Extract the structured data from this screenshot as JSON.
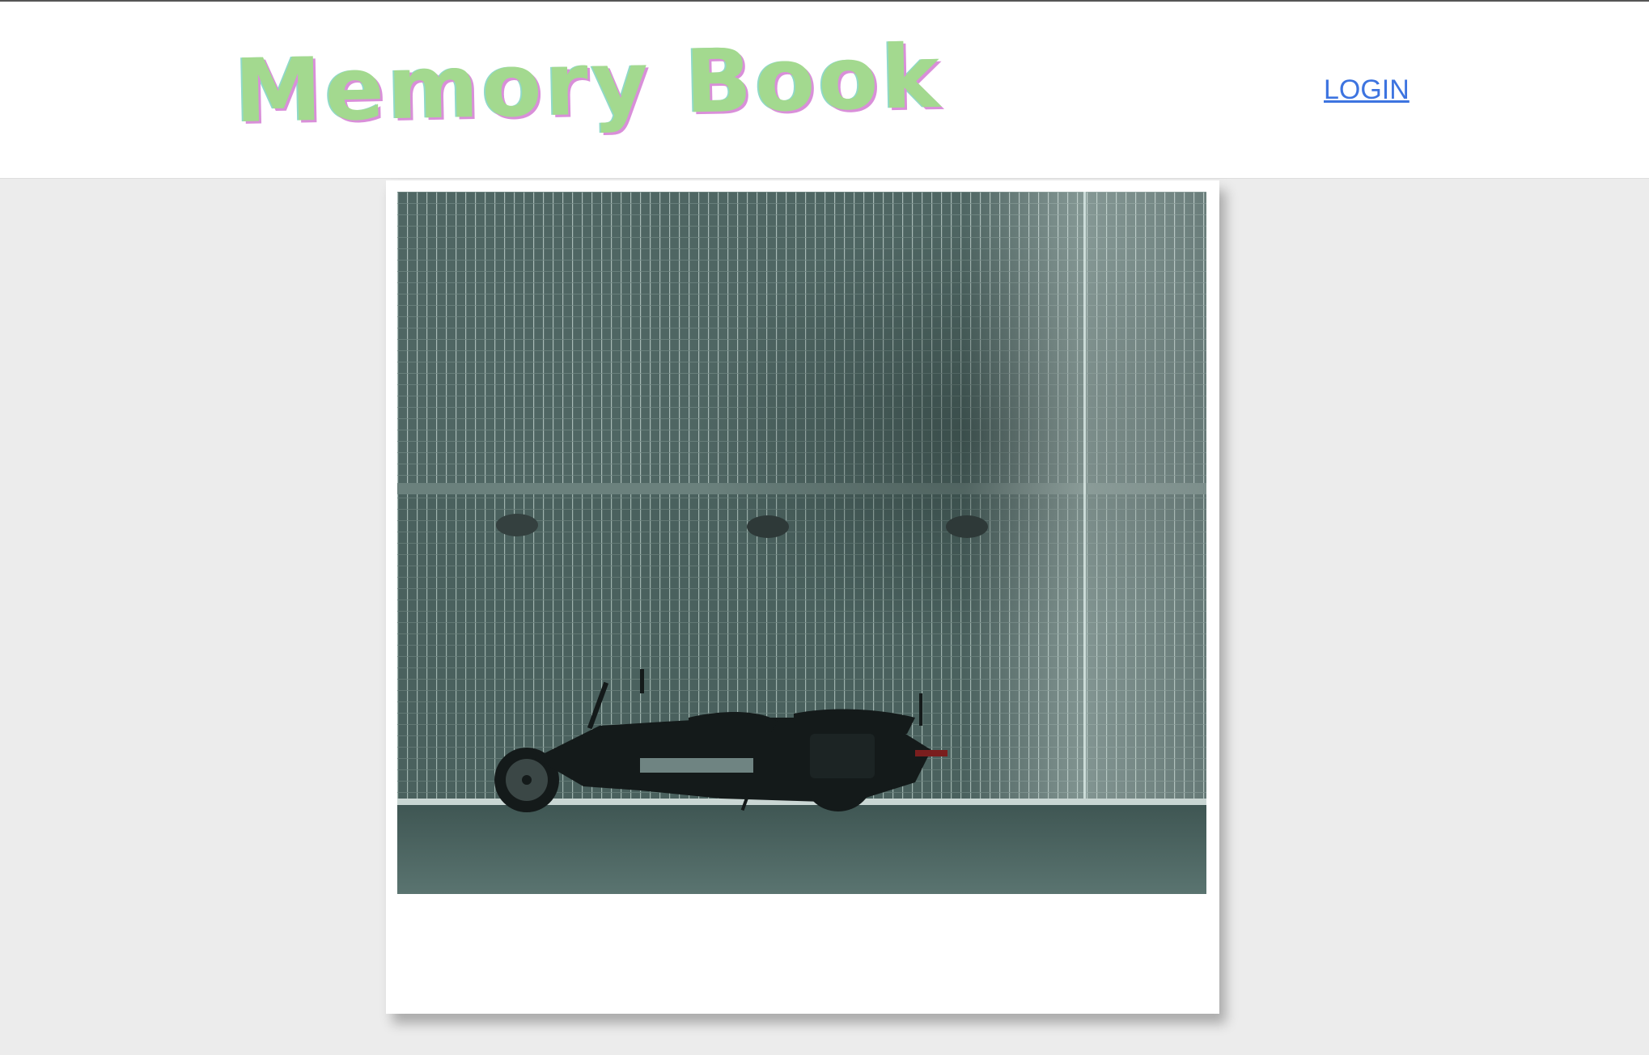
{
  "header": {
    "logo_text": "Memory Book",
    "login_label": "LOGIN"
  },
  "colors": {
    "logo": "#a3d98f",
    "link": "#3d74e0",
    "page_background": "#ececec"
  }
}
